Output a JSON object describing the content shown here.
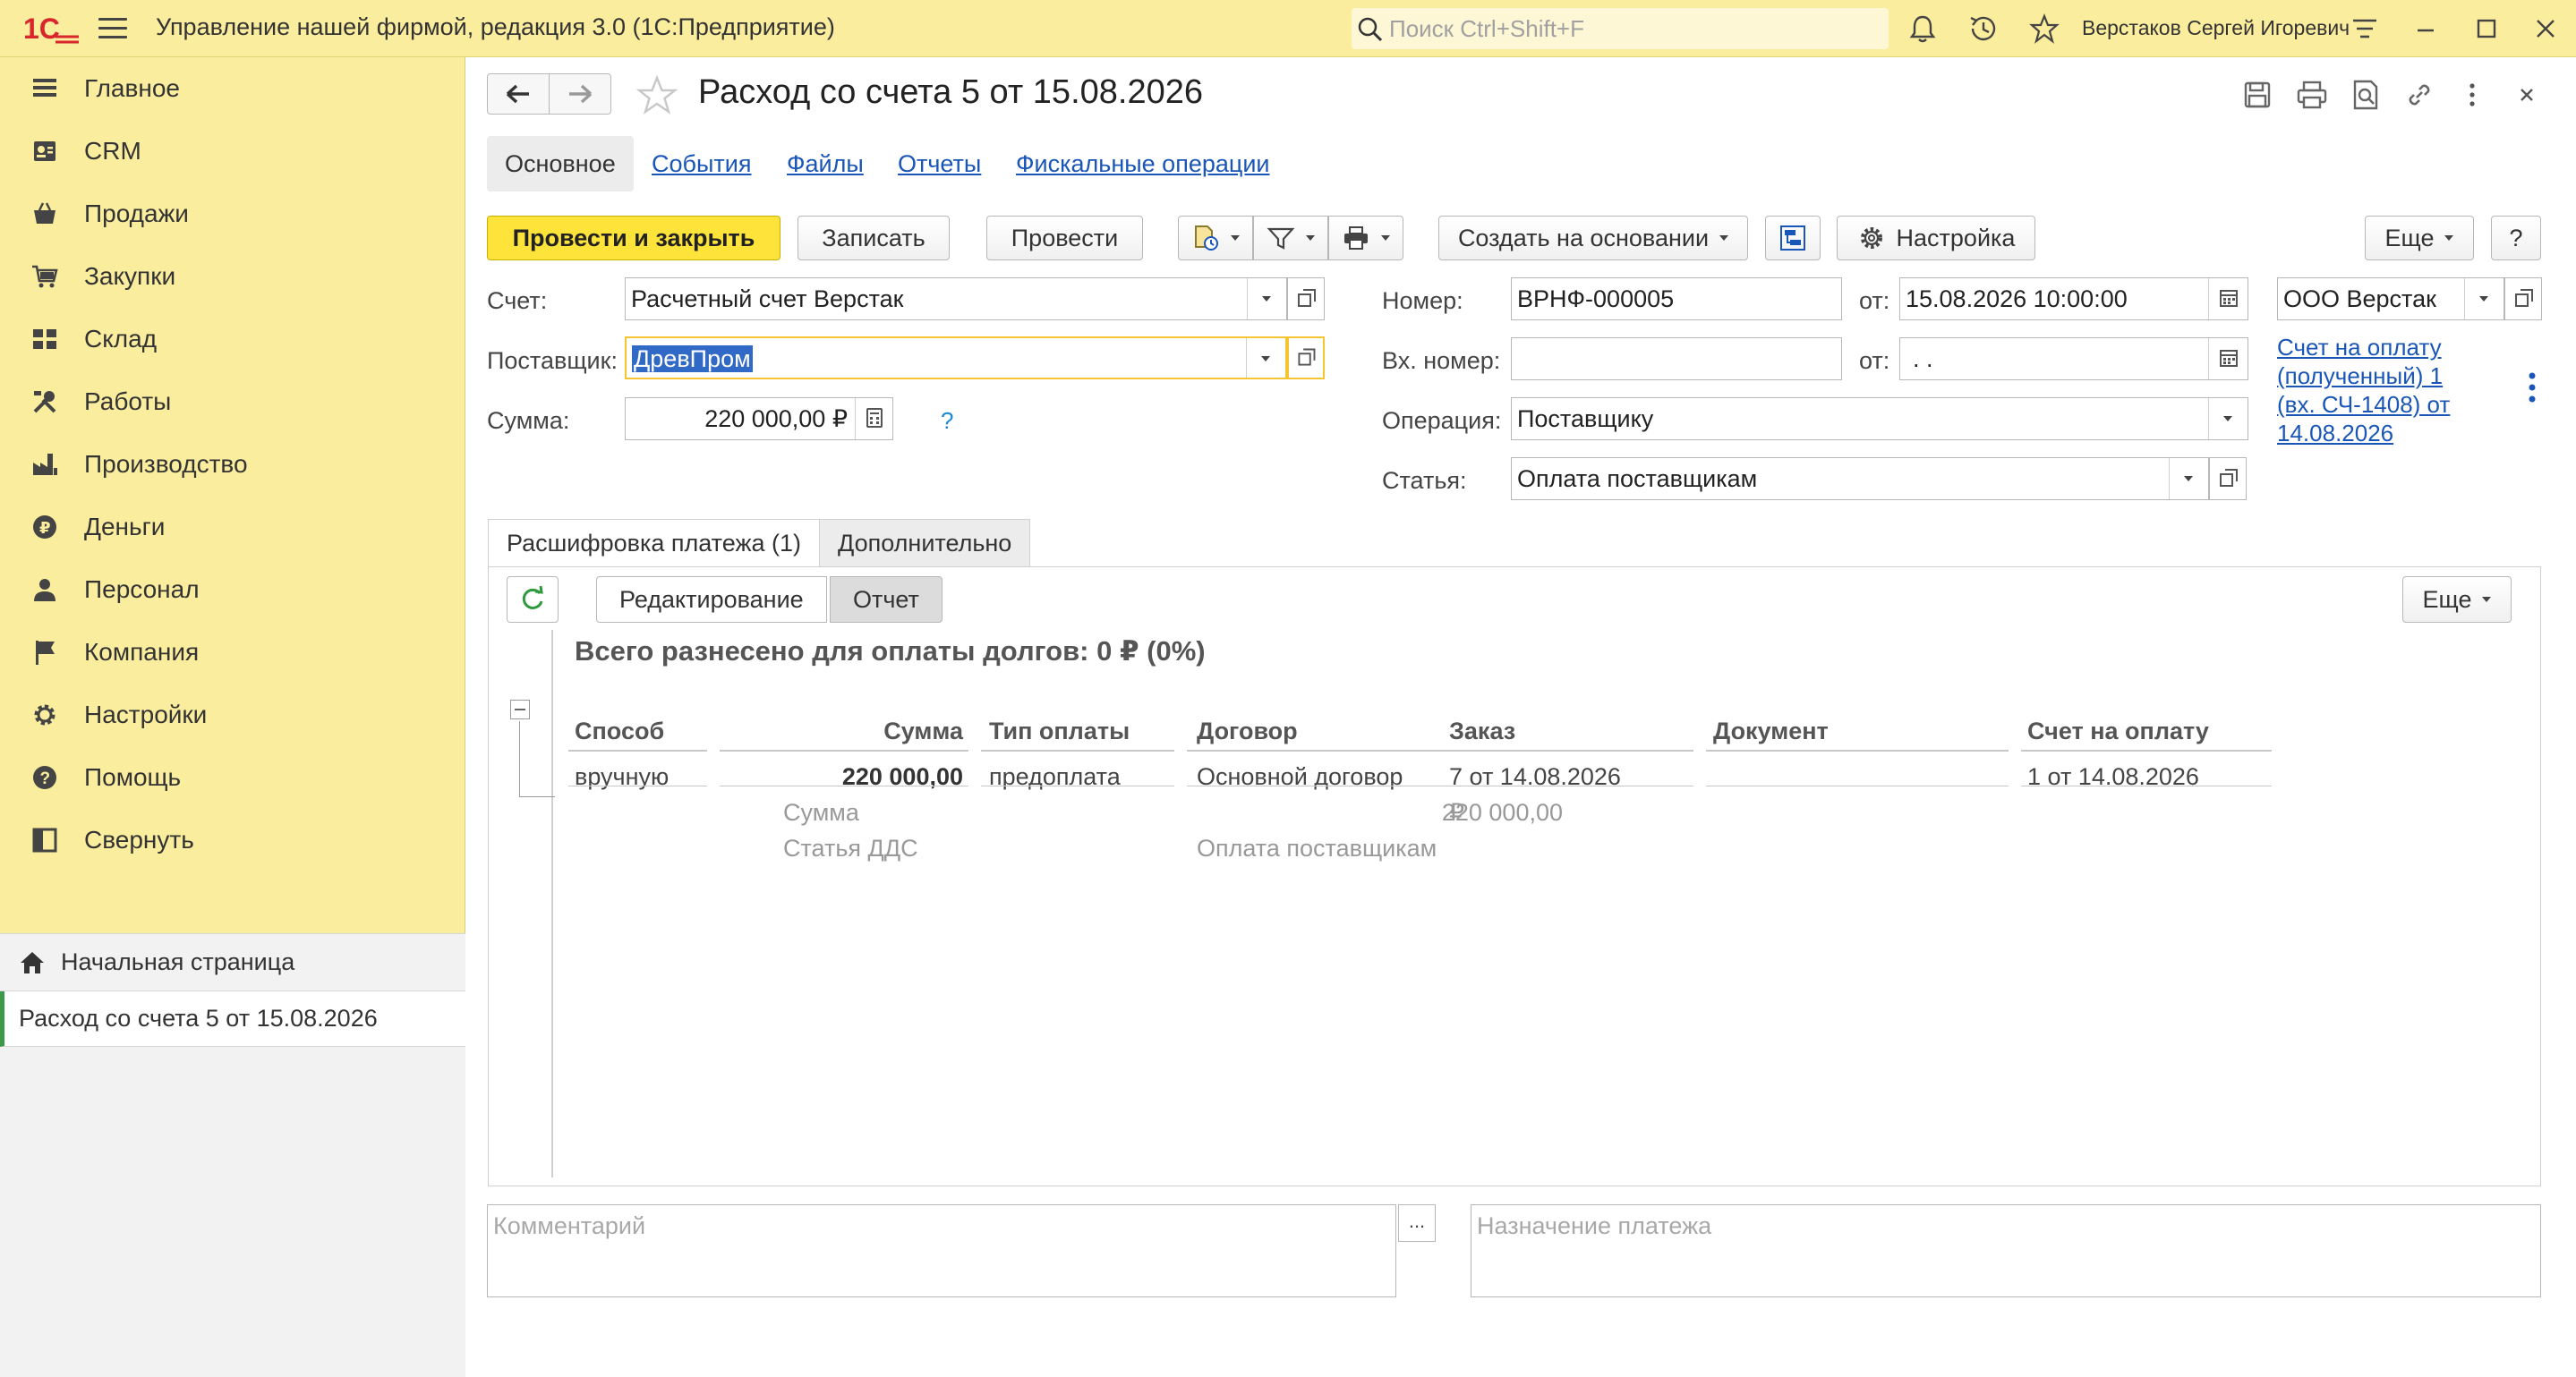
{
  "app": {
    "title": "Управление нашей фирмой, редакция 3.0  (1С:Предприятие)",
    "search_placeholder": "Поиск Ctrl+Shift+F",
    "user": "Верстаков Сергей Игоревич"
  },
  "sidebar": {
    "items": [
      {
        "label": "Главное",
        "icon": "menu-lines-icon"
      },
      {
        "label": "CRM",
        "icon": "contacts-icon"
      },
      {
        "label": "Продажи",
        "icon": "basket-icon"
      },
      {
        "label": "Закупки",
        "icon": "cart-icon"
      },
      {
        "label": "Склад",
        "icon": "warehouse-icon"
      },
      {
        "label": "Работы",
        "icon": "tools-icon"
      },
      {
        "label": "Производство",
        "icon": "factory-icon"
      },
      {
        "label": "Деньги",
        "icon": "ruble-coin-icon"
      },
      {
        "label": "Персонал",
        "icon": "person-icon"
      },
      {
        "label": "Компания",
        "icon": "flag-icon"
      },
      {
        "label": "Настройки",
        "icon": "gear-icon"
      },
      {
        "label": "Помощь",
        "icon": "help-icon"
      },
      {
        "label": "Свернуть",
        "icon": "collapse-panel-icon"
      }
    ],
    "home_page": "Начальная страница",
    "open_document": "Расход со счета 5 от 15.08.2026"
  },
  "form": {
    "title": "Расход со счета 5 от 15.08.2026",
    "tabs": [
      "Основное",
      "События",
      "Файлы",
      "Отчеты",
      "Фискальные операции"
    ],
    "buttons": {
      "post_close": "Провести и закрыть",
      "save": "Записать",
      "post": "Провести",
      "create_based": "Создать на основании",
      "settings": "Настройка",
      "more": "Еще",
      "help": "?"
    },
    "fields": {
      "account_label": "Счет:",
      "account_value": "Расчетный счет Верстак",
      "supplier_label": "Поставщик:",
      "supplier_value": "ДревПром",
      "sum_label": "Сумма:",
      "sum_value": "220 000,00 ₽",
      "sum_hint": "?",
      "number_label": "Номер:",
      "number_value": "ВРНФ-000005",
      "date_label": "от:",
      "date_value": "15.08.2026 10:00:00",
      "in_number_label": "Вх. номер:",
      "in_number_value": "",
      "in_date_label": "от:",
      "in_date_value": " .  .",
      "operation_label": "Операция:",
      "operation_value": "Поставщику",
      "article_label": "Статья:",
      "article_value": "Оплата поставщикам",
      "org_value": "ООО Верстак",
      "invoice_link": "Счет на оплату (полученный) 1 (вх. СЧ-1408) от 14.08.2026"
    },
    "inner_tabs": [
      "Расшифровка платежа (1)",
      "Дополнительно"
    ],
    "panel": {
      "mode_edit": "Редактирование",
      "mode_report": "Отчет",
      "more": "Еще",
      "total": "Всего разнесено для оплаты долгов: 0 ₽ (0%)",
      "columns": [
        "Способ",
        "Сумма",
        "Тип оплаты",
        "Договор",
        "Заказ",
        "Документ",
        "Счет на оплату"
      ],
      "row": {
        "method": "вручную",
        "sum": "220 000,00",
        "pay_type": "предоплата",
        "contract": "Основной договор",
        "order": "7 от 14.08.2026",
        "document": "",
        "invoice": "1 от 14.08.2026"
      },
      "sub_sum_label": "Сумма",
      "sub_sum_value": "220 000,00",
      "sub_currency": "₽",
      "sub_article_label": "Статья ДДС",
      "sub_article_value": "Оплата поставщикам"
    },
    "comment_placeholder": "Комментарий",
    "comment_button": "...",
    "purpose_placeholder": "Назначение платежа"
  },
  "colors": {
    "sidebar": "#FBED9E",
    "primary_button": "#FDE33A",
    "link": "#1A56B8",
    "active_marker": "#3A9A4A"
  }
}
